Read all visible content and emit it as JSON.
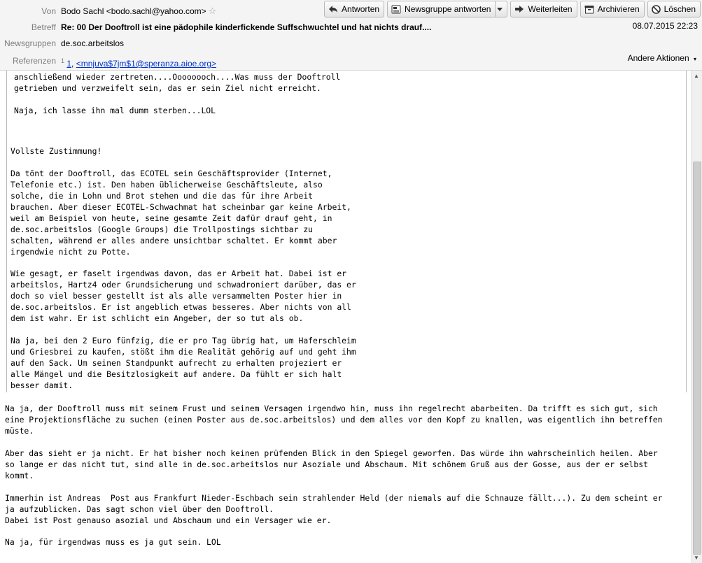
{
  "header": {
    "from_label": "Von",
    "from_value": "Bodo Sachl <bodo.sachl@yahoo.com>",
    "subject_label": "Betreff",
    "subject_value": "Re: 00 Der Dooftroll ist eine pädophile kinderfickende Suffschwuchtel und hat nichts drauf....",
    "newsgroups_label": "Newsgruppen",
    "newsgroups_value": "de.soc.arbeitslos",
    "references_label": "Referenzen",
    "references_sup": "1",
    "references_num": "1",
    "references_link": "<mnjuva$7jm$1@speranza.aioe.org>",
    "date": "08.07.2015 22:23",
    "other_actions": "Andere Aktionen"
  },
  "toolbar": {
    "reply": "Antworten",
    "reply_newsgroup": "Newsgruppe antworten",
    "forward": "Weiterleiten",
    "archive": "Archivieren",
    "delete": "Löschen"
  },
  "body": {
    "quote1": "Da  baut er sich mühsam Sandburgen auf  und dann werden sie ihm\nanschließend wieder zertreten....Oooooooch....Was muss der Dooftroll\ngetrieben und verzweifelt sein, das er sein Ziel nicht erreicht.\n\nNaja, ich lasse ihn mal dumm sterben...LOL",
    "quote2": "Vollste Zustimmung!\n\nDa tönt der Dooftroll, das ECOTEL sein Geschäftsprovider (Internet,\nTelefonie etc.) ist. Den haben üblicherweise Geschäftsleute, also\nsolche, die in Lohn und Brot stehen und die das für ihre Arbeit\nbrauchen. Aber dieser ECOTEL-Schwachmat hat scheinbar gar keine Arbeit,\nweil am Beispiel von heute, seine gesamte Zeit dafür drauf geht, in\nde.soc.arbeitslos (Google Groups) die Trollpostings sichtbar zu\nschalten, während er alles andere unsichtbar schaltet. Er kommt aber\nirgendwie nicht zu Potte.\n\nWie gesagt, er faselt irgendwas davon, das er Arbeit hat. Dabei ist er\narbeitslos, Hartz4 oder Grundsicherung und schwadroniert darüber, das er\ndoch so viel besser gestellt ist als alle versammelten Poster hier in\nde.soc.arbeitslos. Er ist angeblich etwas besseres. Aber nichts von all\ndem ist wahr. Er ist schlicht ein Angeber, der so tut als ob.\n\nNa ja, bei den 2 Euro fünfzig, die er pro Tag übrig hat, um Haferschleim\nund Griesbrei zu kaufen, stößt ihm die Realität gehörig auf und geht ihm\nauf den Sack. Um seinen Standpunkt aufrecht zu erhalten projeziert er\nalle Mängel und die Besitzlosigkeit auf andere. Da fühlt er sich halt\nbesser damit.",
    "reply": "Na ja, der Dooftroll muss mit seinem Frust und seinem Versagen irgendwo hin, muss ihn regelrecht abarbeiten. Da trifft es sich gut, sich\neine Projektionsfläche zu suchen (einen Poster aus de.soc.arbeitslos) und dem alles vor den Kopf zu knallen, was eigentlich ihn betreffen\nmüste.\n\nAber das sieht er ja nicht. Er hat bisher noch keinen prüfenden Blick in den Spiegel geworfen. Das würde ihn wahrscheinlich heilen. Aber\nso lange er das nicht tut, sind alle in de.soc.arbeitslos nur Asoziale und Abschaum. Mit schönem Gruß aus der Gosse, aus der er selbst\nkommt.\n\nImmerhin ist Andreas  Post aus Frankfurt Nieder-Eschbach sein strahlender Held (der niemals auf die Schnauze fällt...). Zu dem scheint er\nja aufzublicken. Das sagt schon viel über den Dooftroll.\nDabei ist Post genauso asozial und Abschaum und ein Versager wie er.\n\nNa ja, für irgendwas muss es ja gut sein. LOL"
  }
}
